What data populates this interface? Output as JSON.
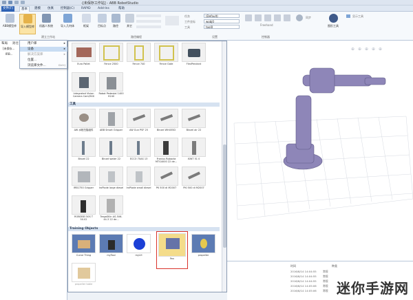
{
  "app": {
    "title": "-[未保存工作站] - ABB RobotStudio"
  },
  "tabs": [
    {
      "label": "文件(F)"
    },
    {
      "label": "基本"
    },
    {
      "label": "建模"
    },
    {
      "label": "仿真"
    },
    {
      "label": "控制器(C)"
    },
    {
      "label": "RAPID"
    },
    {
      "label": "Add-Ins"
    },
    {
      "label": "帮助"
    }
  ],
  "ribbon": {
    "abb_library": "ABB模型库",
    "import_library": "导入模型库",
    "robot_system": "机器人系统",
    "import_geometry": "导入几何体",
    "frame": "框架",
    "target": "目标点",
    "path": "路径",
    "other": "其它",
    "task_label": "任务",
    "task_value": "(Default)",
    "workobj_label": "工件坐标",
    "workobj_value": "wobj0",
    "tool_label": "工具",
    "tool_value": "tool0",
    "freehand": "Freehand",
    "sync": "同步",
    "sim_panel": "图形工具",
    "graphics": "显示工具",
    "build_group": "建立工作站",
    "path_group": "路径编程",
    "settings_group": "设置",
    "controller_group": "控制器"
  },
  "left_panel": {
    "tab1": "布局",
    "tab2": "路径",
    "item1": "[未保存...",
    "item2": "IRB..."
  },
  "import_menu": {
    "items": [
      {
        "label": "用户库"
      },
      {
        "label": "设备"
      },
      {
        "label": "解决方案库"
      },
      {
        "label": "位置..."
      },
      {
        "label": "浏览库文件...",
        "shortcut": "Ctrl+J"
      }
    ]
  },
  "gallery": {
    "row1": [
      {
        "label": "Euro Pallet"
      },
      {
        "label": "Fence 2500"
      },
      {
        "label": "Fence 740"
      },
      {
        "label": "Fence Gate"
      },
      {
        "label": "FlexPendant"
      }
    ],
    "row2": [
      {
        "label": "Integrated Vision Camera Cam/9XX"
      },
      {
        "label": "Robot Pedestal 1400 H240"
      }
    ],
    "tools_category": "工具",
    "tools": [
      {
        "label": "AW 水枪扫描组件"
      },
      {
        "label": "ABB Smart Gripper"
      },
      {
        "label": "AW Gun PSF 25"
      },
      {
        "label": "Binzel WH455D"
      },
      {
        "label": "Binzel air 22"
      },
      {
        "label": "Binzel 22"
      },
      {
        "label": "Binzel water 22"
      },
      {
        "label": "ECCO 70AS 13"
      },
      {
        "label": "Fronius Robacta MTG4000 22 de..."
      },
      {
        "label": "ISWT 51 0"
      },
      {
        "label": "IRB1750 Gripper"
      },
      {
        "label": "IrxPlode large diesel"
      },
      {
        "label": "IrxPlode small diesel"
      },
      {
        "label": "PK 500 di M2007"
      },
      {
        "label": "PKI 500 di M2007"
      },
      {
        "label": "ROBOBEI 50S T 50.02"
      },
      {
        "label": "TregaSKin AS-506-44-3 22 de..."
      }
    ],
    "training_category": "Training Objects",
    "training": [
      {
        "label": "Curve Thing"
      },
      {
        "label": "myTool"
      },
      {
        "label": "myLH"
      },
      {
        "label": "Pen"
      },
      {
        "label": "propeller"
      },
      {
        "label": "propeller table"
      }
    ]
  },
  "log": {
    "col_time": "时间",
    "col_category": "种类",
    "rows": [
      {
        "time": "2016/8/14 14:04:55",
        "category": "常规"
      },
      {
        "time": "2016/8/14 14:04:55",
        "category": "常规"
      },
      {
        "time": "2016/8/14 14:04:55",
        "category": "常规"
      },
      {
        "time": "2016/8/14 14:05:06",
        "category": "常规"
      },
      {
        "time": "2016/8/14 14:05:06",
        "category": "常规"
      }
    ]
  },
  "watermark": {
    "text": "迷你手游网"
  },
  "colors": {
    "accent": "#2e62b4",
    "selection": "#d9322a",
    "robot": "#8e86b8"
  }
}
